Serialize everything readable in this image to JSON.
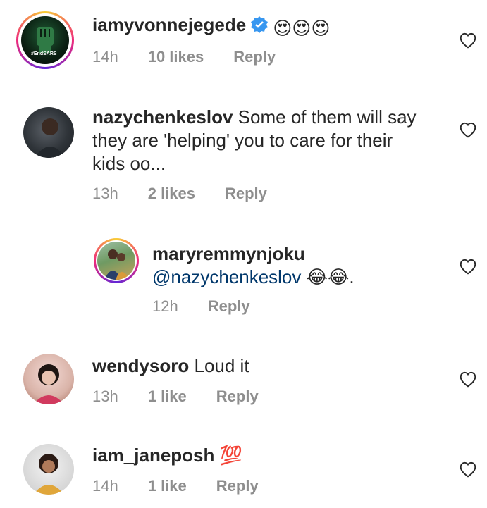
{
  "comments": [
    {
      "username": "iamyvonnejegede",
      "text": "😍😍😍",
      "time": "14h",
      "likes": "10 likes",
      "reply": "Reply",
      "avatar_badge": "#EndSARS"
    },
    {
      "username": "nazychenkeslov",
      "text": "Some of them will say they are 'helping' you to care for their kids oo...",
      "line1": "Some of them will say",
      "line2": "they are 'helping' you to care for their",
      "line3": "kids oo...",
      "time": "13h",
      "likes": "2 likes",
      "reply": "Reply"
    },
    {
      "username": "maryremmynjoku",
      "mention": "@nazychenkeslov",
      "text": "😂😂.",
      "time": "12h",
      "reply": "Reply"
    },
    {
      "username": "wendysoro",
      "text": "Loud it",
      "time": "13h",
      "likes": "1 like",
      "reply": "Reply"
    },
    {
      "username": "iam_janeposh",
      "text": "💯",
      "time": "14h",
      "likes": "1 like",
      "reply": "Reply"
    }
  ],
  "colors": {
    "text": "#262626",
    "meta": "#8e8e8e",
    "mention": "#00376b",
    "verified": "#3897f0"
  }
}
